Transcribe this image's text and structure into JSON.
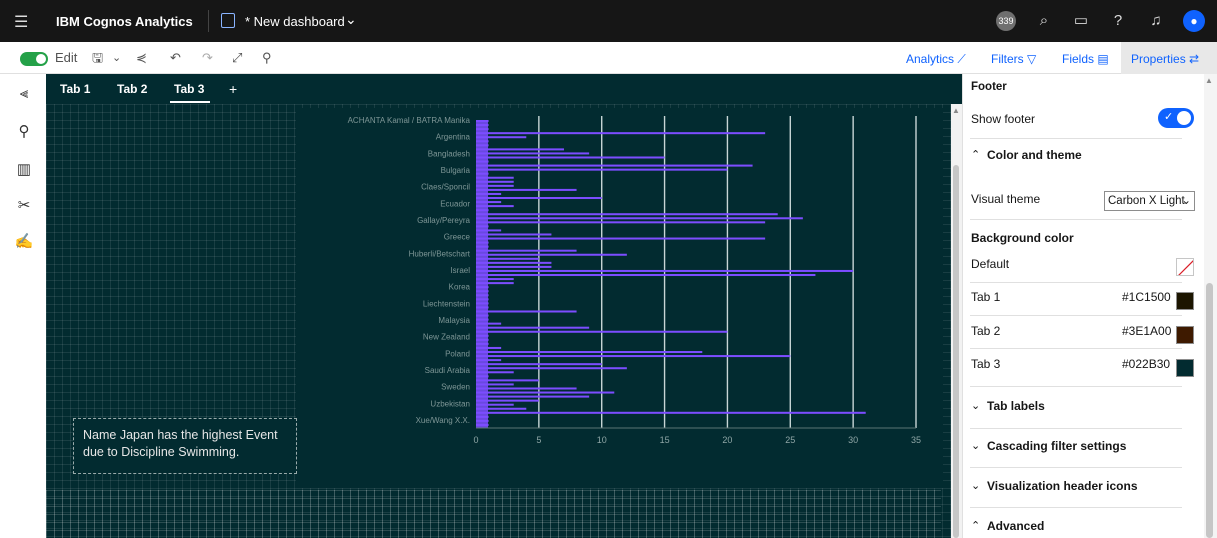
{
  "topbar": {
    "brand": "IBM Cognos Analytics",
    "dashboard_name": "* New dashboard",
    "notification_count": "339"
  },
  "toolbar": {
    "edit_label": "Edit",
    "analytics_label": "Analytics",
    "filters_label": "Filters",
    "fields_label": "Fields",
    "properties_label": "Properties"
  },
  "tabs": [
    {
      "label": "Tab 1"
    },
    {
      "label": "Tab 2"
    },
    {
      "label": "Tab 3"
    },
    {
      "label": "+"
    }
  ],
  "text_widget": "Name Japan has the highest Event due to Discipline Swimming.",
  "properties": {
    "footer_heading": "Footer",
    "show_footer_label": "Show footer",
    "show_footer_on": true,
    "color_theme_heading": "Color and theme",
    "visual_theme_label": "Visual theme",
    "visual_theme_value": "Carbon X Light",
    "background_color_heading": "Background color",
    "default_label": "Default",
    "tab_colors": [
      {
        "label": "Tab 1",
        "hex": "#1C1500",
        "color": "#1C1500"
      },
      {
        "label": "Tab 2",
        "hex": "#3E1A00",
        "color": "#3E1A00"
      },
      {
        "label": "Tab 3",
        "hex": "#022B30",
        "color": "#022B30"
      }
    ],
    "sections": [
      {
        "label": "Tab labels"
      },
      {
        "label": "Cascading filter settings"
      },
      {
        "label": "Visualization header icons"
      },
      {
        "label": "Advanced"
      }
    ]
  },
  "colors": {
    "canvas_bg": "#022B30",
    "bar": "#7C4DFF",
    "accent": "#0F62FE"
  },
  "chart_data": {
    "type": "bar",
    "orientation": "horizontal",
    "xlim": [
      0,
      35
    ],
    "x_ticks": [
      "0",
      "5",
      "10",
      "15",
      "20",
      "25",
      "30",
      "35"
    ],
    "category_labels": [
      "ACHANTA Kamal / BATRA Manika",
      "Argentina",
      "Bangladesh",
      "Bulgaria",
      "Claes/Sponcil",
      "Ecuador",
      "Gallay/Pereyra",
      "Greece",
      "Huberli/Betschart",
      "Israel",
      "Korea",
      "Liechtenstein",
      "Malaysia",
      "New Zealand",
      "Poland",
      "Saudi Arabia",
      "Sweden",
      "Uzbekistan",
      "Xue/Wang X.X."
    ],
    "values": [
      1,
      1,
      1,
      23,
      4,
      1,
      1,
      7,
      9,
      15,
      1,
      22,
      20,
      1,
      3,
      3,
      3,
      8,
      2,
      10,
      2,
      3,
      1,
      24,
      26,
      23,
      1,
      2,
      6,
      23,
      1,
      1,
      8,
      12,
      5,
      6,
      6,
      30,
      27,
      3,
      3,
      1,
      1,
      1,
      1,
      1,
      1,
      8,
      1,
      1,
      2,
      9,
      20,
      1,
      1,
      1,
      2,
      18,
      25,
      2,
      10,
      12,
      3,
      1,
      5,
      3,
      8,
      11,
      9,
      5,
      3,
      4,
      31,
      1,
      1,
      1
    ]
  }
}
